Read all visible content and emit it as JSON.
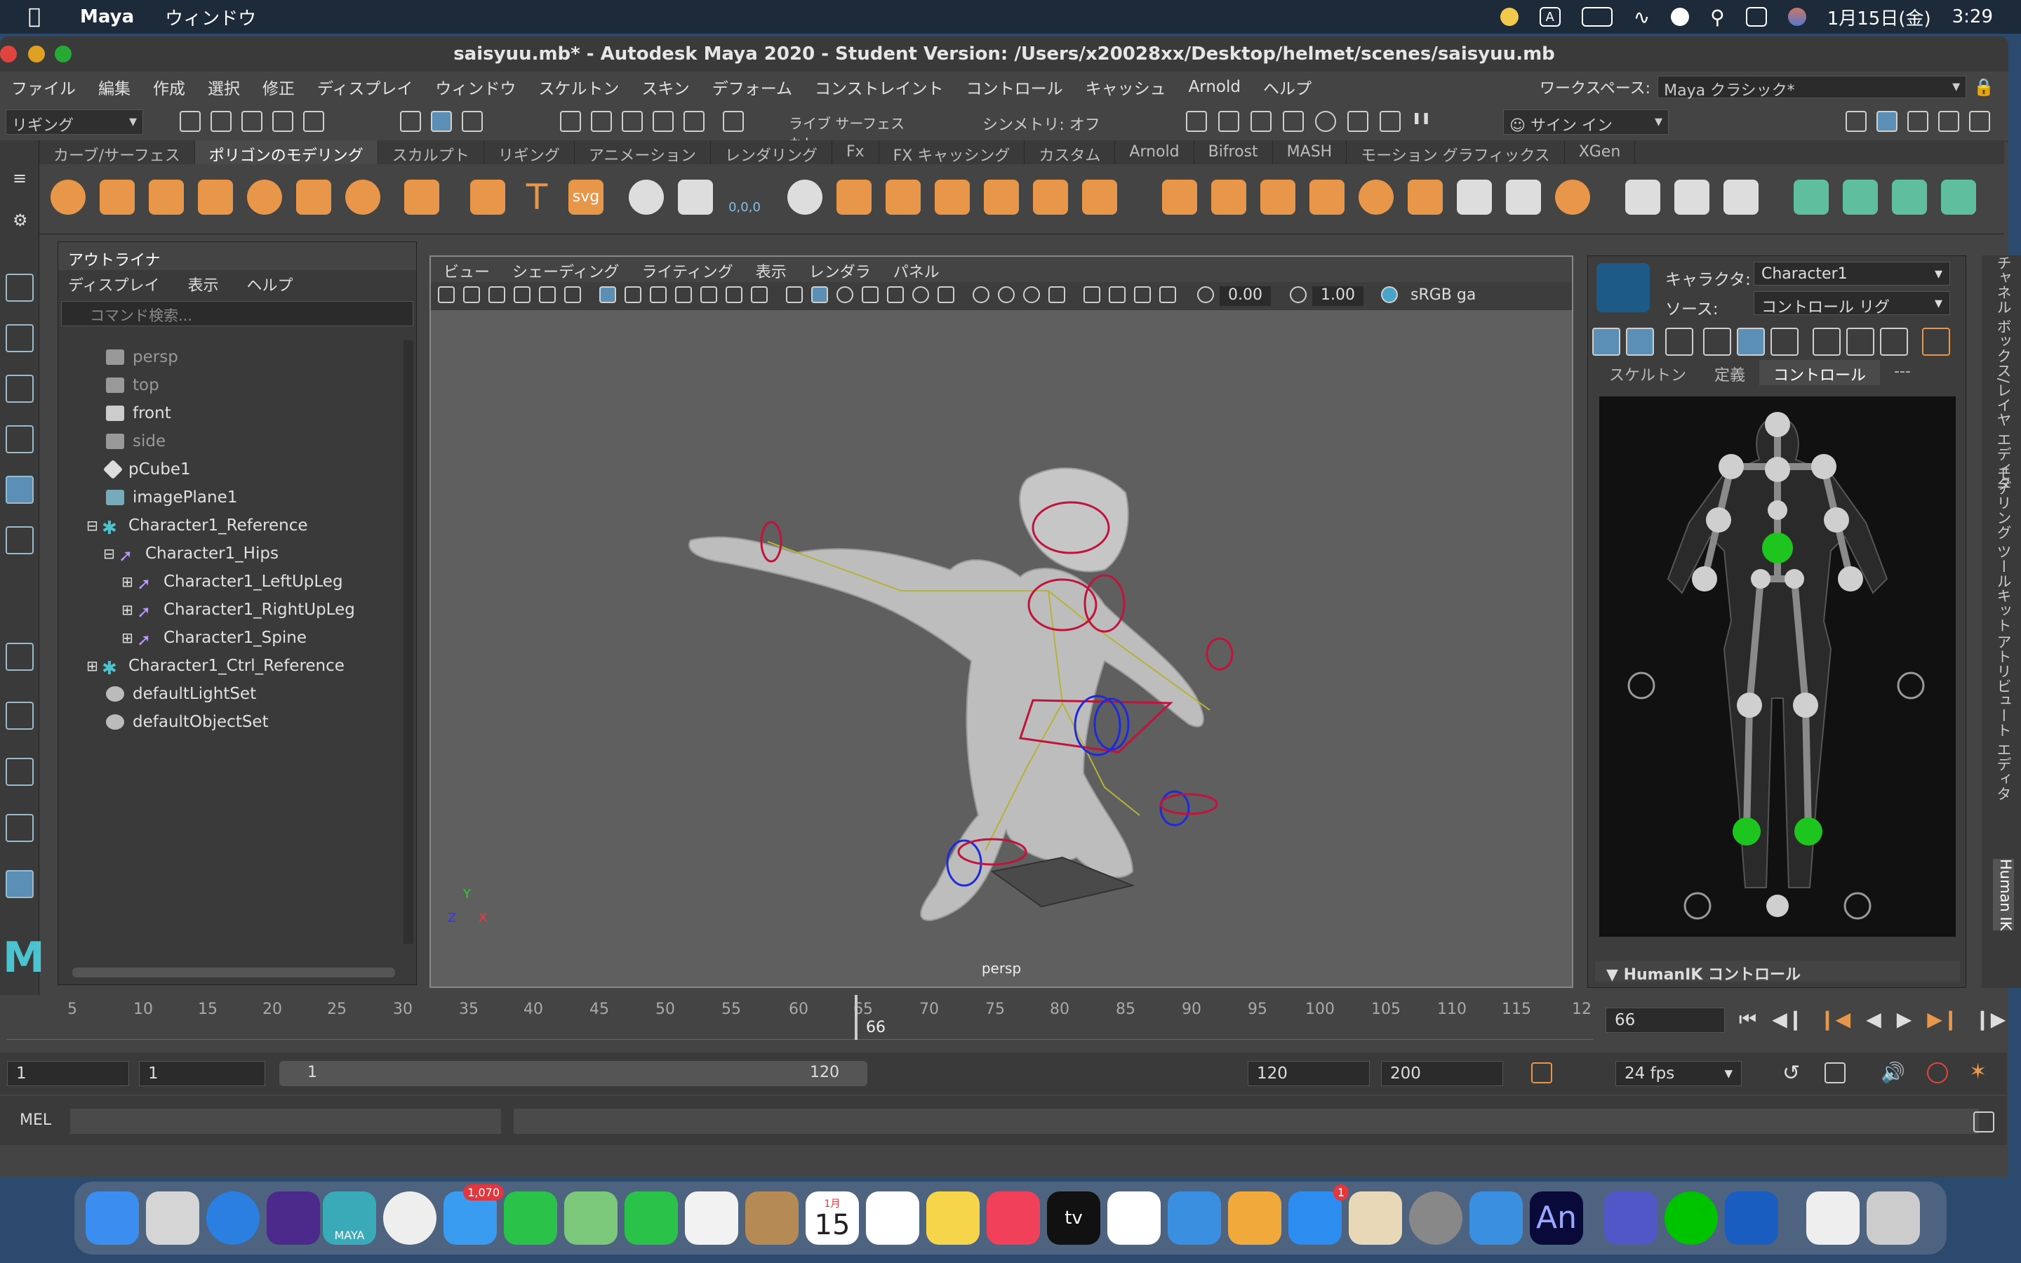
{
  "macmenu": {
    "app": "Maya",
    "menu": "ウィンドウ",
    "date": "1月15日(金)",
    "time": "3:29",
    "input_icon": "A"
  },
  "window": {
    "title": "saisyuu.mb* - Autodesk Maya 2020 - Student Version: /Users/x20028xx/Desktop/helmet/scenes/saisyuu.mb"
  },
  "mainmenu": [
    "ファイル",
    "編集",
    "作成",
    "選択",
    "修正",
    "ディスプレイ",
    "ウィンドウ",
    "スケルトン",
    "スキン",
    "デフォーム",
    "コンストレイント",
    "コントロール",
    "キャッシュ",
    "Arnold",
    "ヘルプ"
  ],
  "workspace": {
    "label": "ワークスペース:",
    "value": "Maya クラシック*"
  },
  "statusline": {
    "mode": "リギング",
    "live": "ライブ サーフェスなし",
    "symmetry": "シンメトリ: オフ",
    "signin": "サイン イン"
  },
  "shelf_tabs": [
    "カーブ/サーフェス",
    "ポリゴンのモデリング",
    "スカルプト",
    "リギング",
    "アニメーション",
    "レンダリング",
    "Fx",
    "FX キャッシング",
    "カスタム",
    "Arnold",
    "Bifrost",
    "MASH",
    "モーション グラフィックス",
    "XGen"
  ],
  "shelf_active": "ポリゴンのモデリング",
  "shelf_text_icons": {
    "text": "T",
    "svg": "svg",
    "snow": "0,0,0"
  },
  "outliner": {
    "title": "アウトライナ",
    "menu": [
      "ディスプレイ",
      "表示",
      "ヘルプ"
    ],
    "search_placeholder": "コマンド検索...",
    "items": [
      {
        "label": "persp",
        "dim": true
      },
      {
        "label": "top",
        "dim": true
      },
      {
        "label": "front",
        "dim": false
      },
      {
        "label": "side",
        "dim": true
      },
      {
        "label": "pCube1",
        "dim": false
      },
      {
        "label": "imagePlane1",
        "dim": false
      },
      {
        "label": "Character1_Reference",
        "dim": false
      },
      {
        "label": "Character1_Hips",
        "dim": false
      },
      {
        "label": "Character1_LeftUpLeg",
        "dim": false
      },
      {
        "label": "Character1_RightUpLeg",
        "dim": false
      },
      {
        "label": "Character1_Spine",
        "dim": false
      },
      {
        "label": "Character1_Ctrl_Reference",
        "dim": false
      },
      {
        "label": "defaultLightSet",
        "dim": false
      },
      {
        "label": "defaultObjectSet",
        "dim": false
      }
    ]
  },
  "viewport": {
    "menu": [
      "ビュー",
      "シェーディング",
      "ライティング",
      "表示",
      "レンダラ",
      "パネル"
    ],
    "exposure": "0.00",
    "gamma": "1.00",
    "colorspace": "sRGB ga",
    "camera": "persp",
    "axis": {
      "y": "Y",
      "z": "Z",
      "x": "X"
    }
  },
  "hik": {
    "character_label": "キャラクタ:",
    "character": "Character1",
    "source_label": "ソース:",
    "source": "コントロール リグ",
    "tabs": [
      "スケルトン",
      "定義",
      "コントロール",
      "---"
    ],
    "active_tab": "コントロール",
    "footer": "HumanIK コントロール"
  },
  "sidetabs": [
    "モデリング ツールキット",
    "アトリビュート エディタ",
    "チャネル ボックス/レイヤ エディタ",
    "Human IK"
  ],
  "timeline": {
    "ticks": [
      "5",
      "10",
      "15",
      "20",
      "25",
      "30",
      "35",
      "40",
      "45",
      "50",
      "55",
      "60",
      "65",
      "70",
      "75",
      "80",
      "85",
      "90",
      "95",
      "100",
      "105",
      "110",
      "115",
      "12"
    ],
    "current": "66",
    "current_field": "66"
  },
  "range": {
    "start": "1",
    "anim_start": "1",
    "slider_start": "1",
    "slider_end": "120",
    "end": "120",
    "anim_end": "200",
    "fps": "24 fps"
  },
  "cmd": {
    "lang": "MEL"
  },
  "dock": {
    "mail_badge": "1,070",
    "appstore_badge": "1",
    "calendar_month": "1月",
    "calendar_day": "15",
    "maya_label": "MAYA",
    "an_label": "An",
    "tv_label": "tv"
  }
}
